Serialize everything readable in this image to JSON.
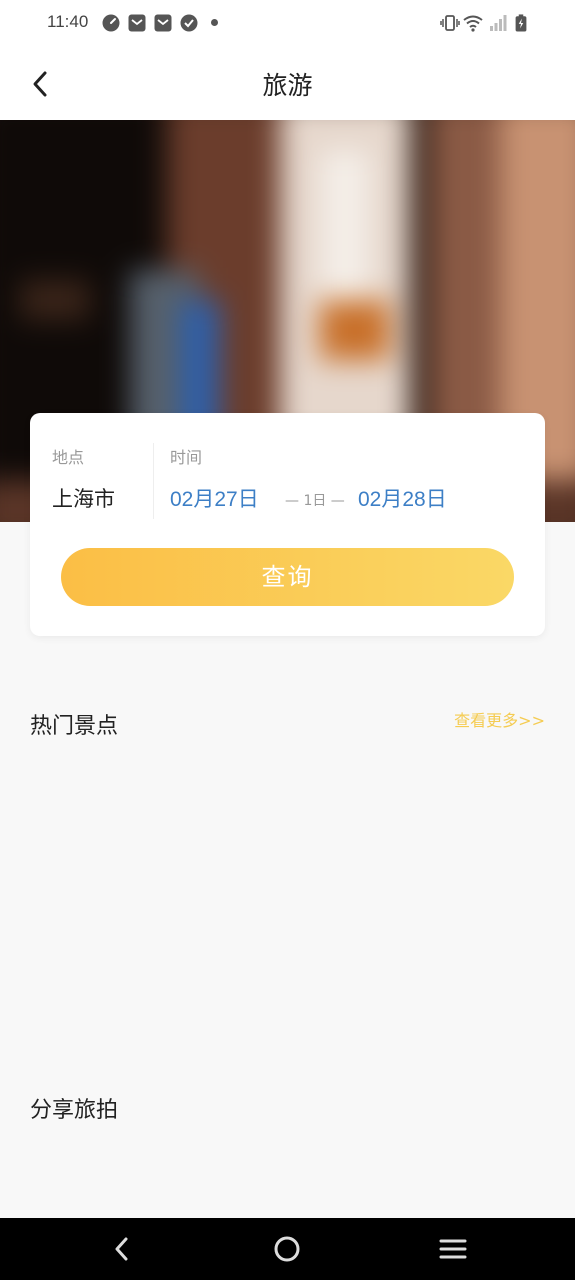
{
  "status_bar": {
    "time": "11:40",
    "left_icons": [
      "speedometer-icon",
      "mail-icon",
      "mail-icon",
      "check-circle-icon",
      "dot-icon"
    ],
    "right_icons": [
      "vibrate-icon",
      "wifi-icon",
      "signal-icon",
      "battery-charging-icon"
    ]
  },
  "header": {
    "title": "旅游",
    "back_icon": "chevron-left-icon"
  },
  "search": {
    "location_label": "地点",
    "location_value": "上海市",
    "time_label": "时间",
    "start_date": "02月27日",
    "nights": "— 1日 —",
    "end_date": "02月28日",
    "query_label": "查询",
    "button_gradient": [
      "#fbbe45",
      "#fad866"
    ],
    "date_color": "#3d7fc6"
  },
  "hot_spots": {
    "title": "热门景点",
    "more_label": "查看更多>>",
    "more_color": "#f5cc52"
  },
  "share": {
    "title": "分享旅拍"
  },
  "system_nav": {
    "buttons": [
      "back-icon",
      "home-icon",
      "menu-icon"
    ]
  }
}
